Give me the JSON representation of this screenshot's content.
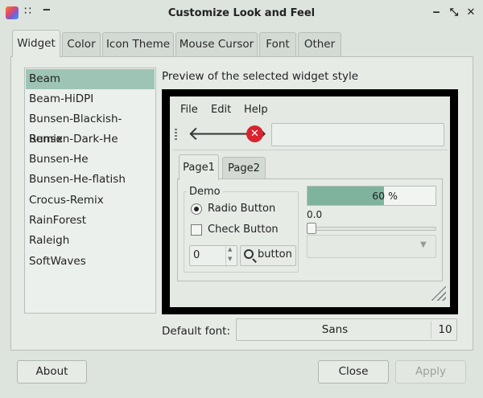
{
  "window": {
    "title": "Customize Look and Feel",
    "dots_glyph": "∷",
    "dash_glyph": "‒"
  },
  "title_buttons": {
    "minimize": "‒",
    "restore": "⤡",
    "close": "✕"
  },
  "tabs": [
    {
      "label": "Widget"
    },
    {
      "label": "Color"
    },
    {
      "label": "Icon Theme"
    },
    {
      "label": "Mouse Cursor"
    },
    {
      "label": "Font"
    },
    {
      "label": "Other"
    }
  ],
  "styles": [
    {
      "label": "Beam"
    },
    {
      "label": "Beam-HiDPI"
    },
    {
      "label": "Bunsen-Blackish-Remix"
    },
    {
      "label": "Bunsen-Dark-He"
    },
    {
      "label": "Bunsen-He"
    },
    {
      "label": "Bunsen-He-flatish"
    },
    {
      "label": "Crocus-Remix"
    },
    {
      "label": "RainForest"
    },
    {
      "label": "Raleigh"
    },
    {
      "label": "SoftWaves"
    }
  ],
  "preview": {
    "label": "Preview of the selected widget style",
    "menu": {
      "file": "File",
      "edit": "Edit",
      "help": "Help"
    },
    "toolbar": {
      "back_glyph": "🡐",
      "forward_glyph": "🡒",
      "stop_glyph": "✕"
    },
    "tabs": {
      "page1": "Page1",
      "page2": "Page2"
    },
    "group_title": "Demo",
    "radio_label": "Radio Button",
    "check_label": "Check Button",
    "spin_value": "0",
    "spin_up": "▲",
    "spin_down": "▼",
    "button_label": "button",
    "progress_text": "60 %",
    "progress_fraction": 0.6,
    "slider_value": "0.0",
    "combo_arrow": "▼"
  },
  "default_font": {
    "label": "Default font:",
    "name": "Sans",
    "size": "10"
  },
  "buttons": {
    "about": "About",
    "close": "Close",
    "apply": "Apply"
  }
}
